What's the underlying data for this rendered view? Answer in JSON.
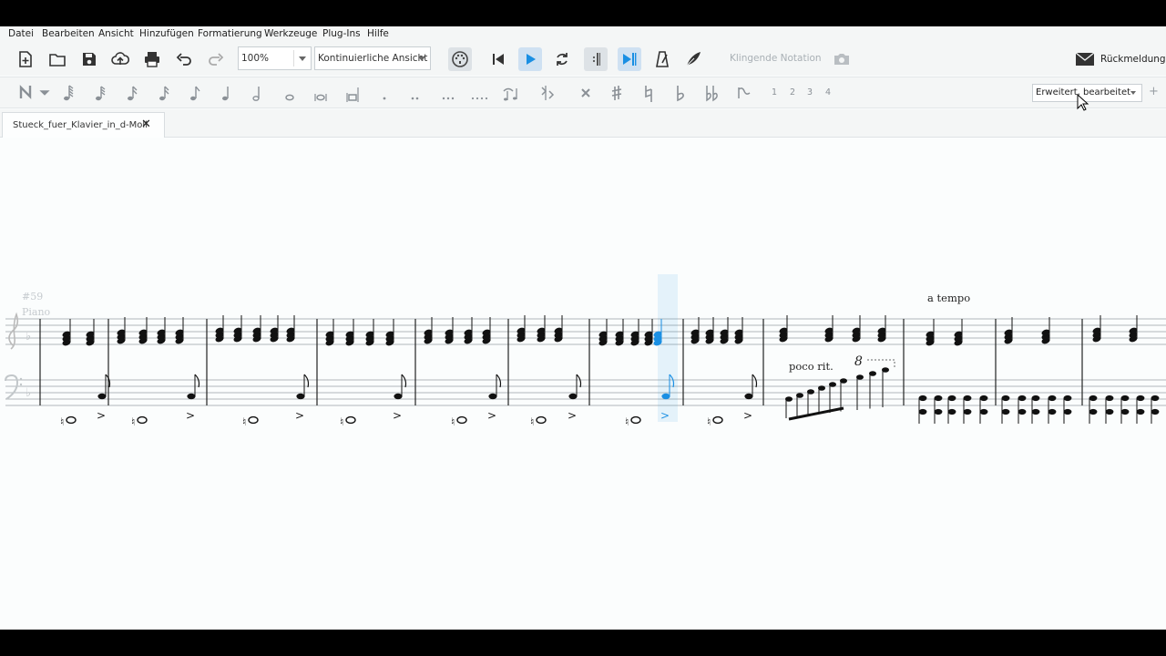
{
  "menu": {
    "items": [
      {
        "label": "Datei"
      },
      {
        "label": "Bearbeiten"
      },
      {
        "label": "Ansicht"
      },
      {
        "label": "Hinzufügen"
      },
      {
        "label": "Formatierung"
      },
      {
        "label": "Werkzeuge"
      },
      {
        "label": "Plug-Ins"
      },
      {
        "label": "Hilfe"
      }
    ]
  },
  "toolbar": {
    "zoom_value": "100%",
    "view_mode": "Kontinuierliche Ansicht",
    "concert_pitch_label": "Klingende Notation",
    "feedback_label": "Rückmeldung"
  },
  "note_input": {
    "voices": [
      "1",
      "2",
      "3",
      "4"
    ],
    "workspace": "Erweitert, bearbeitet",
    "add_label": "+"
  },
  "tabs": [
    {
      "label": "Stueck_fuer_Klavier_in_d-Moll",
      "close": "✕"
    }
  ],
  "score": {
    "measure_number": "#59",
    "instrument": "Piano",
    "tempo_text": "a tempo",
    "rit_text": "poco rit.",
    "ottava": "8",
    "accent_symbol": ">",
    "selection_color": "#1a8fe3"
  },
  "colors": {
    "accent": "#1a8fe3",
    "active_button_bg": "#cfe1f2"
  }
}
